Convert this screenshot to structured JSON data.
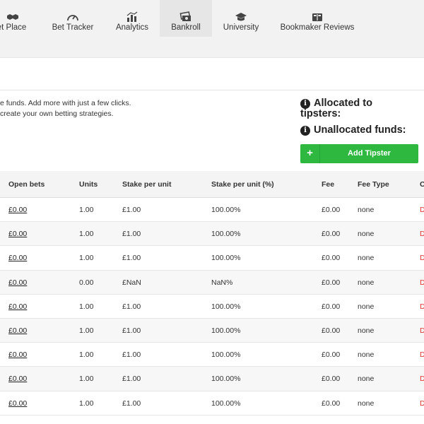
{
  "nav": {
    "tabs": [
      {
        "label": "ket Place",
        "icon": "handshake-icon"
      },
      {
        "label": "Bet Tracker",
        "icon": "speedometer-icon"
      },
      {
        "label": "Analytics",
        "icon": "bar-chart-icon"
      },
      {
        "label": "Bankroll",
        "icon": "money-icon",
        "active": true
      },
      {
        "label": "University",
        "icon": "graduation-cap-icon"
      },
      {
        "label": "Bookmaker Reviews",
        "icon": "book-icon"
      }
    ]
  },
  "info": {
    "line1": "e funds. Add more with just a few clicks.",
    "line2": "create your own betting strategies."
  },
  "stats": {
    "allocated_line1": "Allocated to",
    "allocated_line2": "tipsters:",
    "unallocated": "Unallocated funds:"
  },
  "add_button": {
    "plus": "+",
    "label": "Add Tipster"
  },
  "table": {
    "headers": {
      "open_bets": "Open bets",
      "units": "Units",
      "stake_per_unit": "Stake per unit",
      "stake_pct": "Stake per unit (%)",
      "fee": "Fee",
      "fee_type": "Fee Type",
      "last": "C"
    },
    "rows": [
      {
        "open_bets": "£0.00",
        "units": "1.00",
        "stake": "£1.00",
        "pct": "100.00%",
        "fee": "£0.00",
        "fee_type": "none",
        "last": "D"
      },
      {
        "open_bets": "£0.00",
        "units": "1.00",
        "stake": "£1.00",
        "pct": "100.00%",
        "fee": "£0.00",
        "fee_type": "none",
        "last": "D"
      },
      {
        "open_bets": "£0.00",
        "units": "1.00",
        "stake": "£1.00",
        "pct": "100.00%",
        "fee": "£0.00",
        "fee_type": "none",
        "last": "D"
      },
      {
        "open_bets": "£0.00",
        "units": "0.00",
        "stake": "£NaN",
        "pct": "NaN%",
        "fee": "£0.00",
        "fee_type": "none",
        "last": "D"
      },
      {
        "open_bets": "£0.00",
        "units": "1.00",
        "stake": "£1.00",
        "pct": "100.00%",
        "fee": "£0.00",
        "fee_type": "none",
        "last": "D"
      },
      {
        "open_bets": "£0.00",
        "units": "1.00",
        "stake": "£1.00",
        "pct": "100.00%",
        "fee": "£0.00",
        "fee_type": "none",
        "last": "D"
      },
      {
        "open_bets": "£0.00",
        "units": "1.00",
        "stake": "£1.00",
        "pct": "100.00%",
        "fee": "£0.00",
        "fee_type": "none",
        "last": "D"
      },
      {
        "open_bets": "£0.00",
        "units": "1.00",
        "stake": "£1.00",
        "pct": "100.00%",
        "fee": "£0.00",
        "fee_type": "none",
        "last": "D"
      },
      {
        "open_bets": "£0.00",
        "units": "1.00",
        "stake": "£1.00",
        "pct": "100.00%",
        "fee": "£0.00",
        "fee_type": "none",
        "last": "D"
      }
    ]
  },
  "colors": {
    "accent_green": "#2eb840",
    "delete_red": "#e03030"
  }
}
